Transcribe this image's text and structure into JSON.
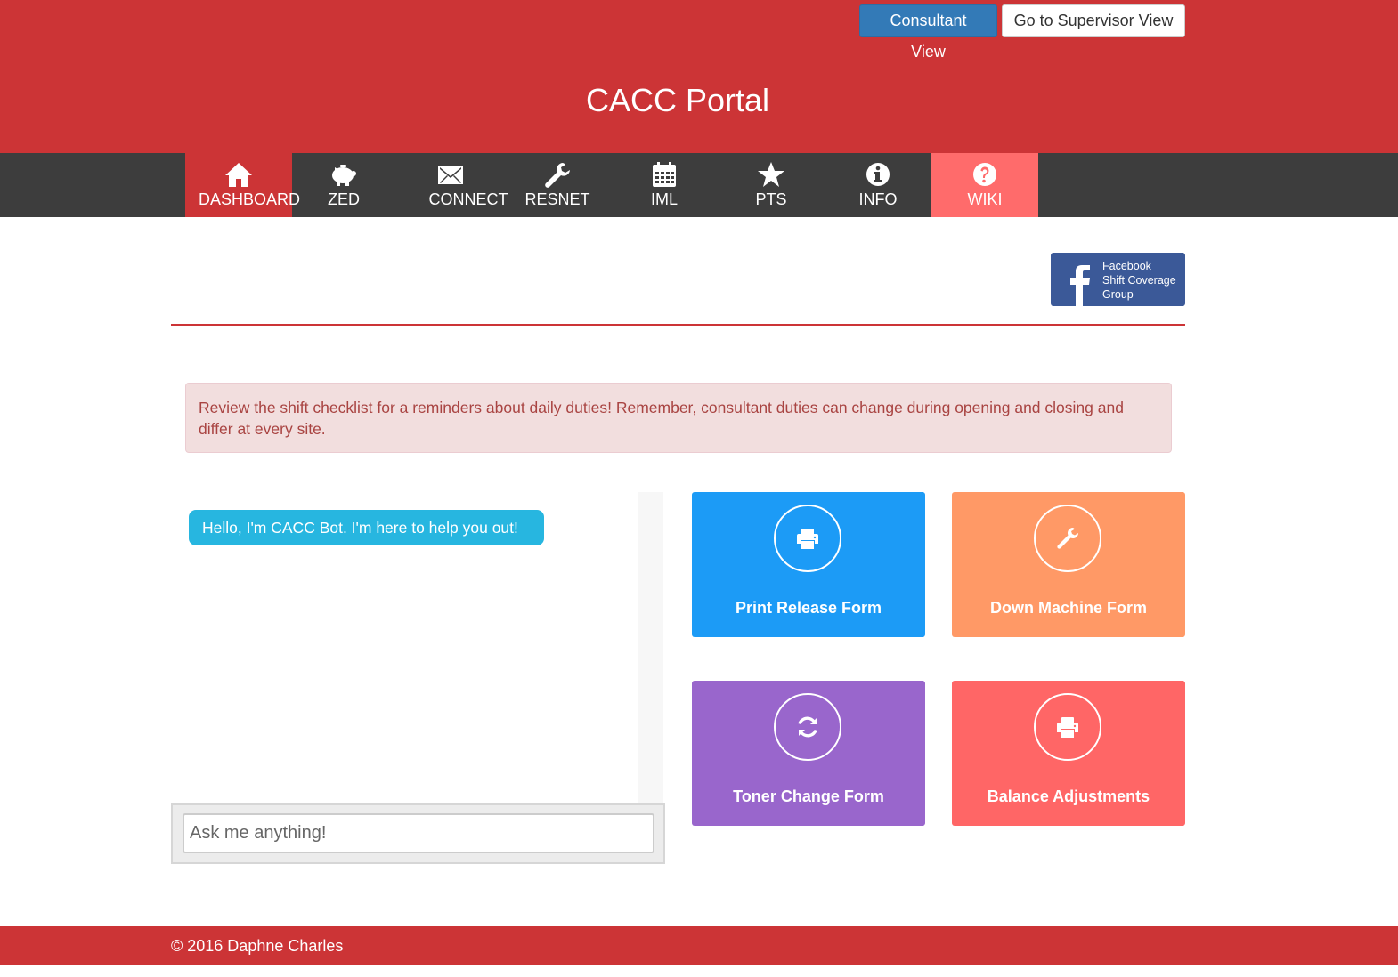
{
  "header": {
    "title": "CACC Portal",
    "consultant_view_label": "Consultant View",
    "supervisor_view_label": "Go to Supervisor View"
  },
  "nav": {
    "items": [
      {
        "label": "DASHBOARD",
        "icon": "home-icon"
      },
      {
        "label": "ZED",
        "icon": "piggy-bank-icon"
      },
      {
        "label": "CONNECT",
        "icon": "envelope-icon"
      },
      {
        "label": "RESNET",
        "icon": "wrench-icon"
      },
      {
        "label": "IML",
        "icon": "calendar-icon"
      },
      {
        "label": "PTS",
        "icon": "star-icon"
      },
      {
        "label": "INFO",
        "icon": "info-icon"
      },
      {
        "label": "WIKI",
        "icon": "question-icon"
      }
    ]
  },
  "facebook": {
    "line1": "Facebook",
    "line2": "Shift Coverage",
    "line3": "Group"
  },
  "alert": {
    "text": "Review the shift checklist for a reminders about daily duties! Remember, consultant duties can change during opening and closing and differ at every site."
  },
  "chat": {
    "bot_message": "Hello, I'm CACC Bot. I'm here to help you out!",
    "input_placeholder": "Ask me anything!"
  },
  "tiles": [
    {
      "label": "Print Release Form",
      "icon": "print-icon",
      "color": "#1c9bf6"
    },
    {
      "label": "Down Machine Form",
      "icon": "wrench-icon",
      "color": "#ff9966"
    },
    {
      "label": "Toner Change Form",
      "icon": "refresh-icon",
      "color": "#9966cc"
    },
    {
      "label": "Balance Adjustments",
      "icon": "print-icon",
      "color": "#ff6666"
    }
  ],
  "footer": {
    "text": "© 2016 Daphne Charles"
  },
  "colors": {
    "brand_red": "#cc3436",
    "nav_dark": "#3d3d3d",
    "wiki_pink": "#ff6b6b",
    "facebook_blue": "#3b5998",
    "alert_bg": "#f2dede",
    "alert_text": "#a94442",
    "bot_bubble": "#27b6e0"
  }
}
